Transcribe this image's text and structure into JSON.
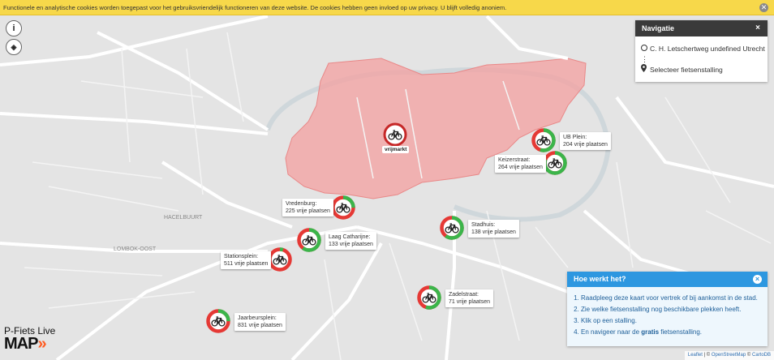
{
  "cookie": {
    "text": "Functionele en analytische cookies worden toegepast voor het gebruiksvriendelijk functioneren van deze website. De cookies hebben geen invloed op uw privacy. U blijft volledig anoniem.",
    "close_icon": "✕"
  },
  "map_controls": {
    "info_glyph": "i",
    "directions_glyph": "◈"
  },
  "map_labels": {
    "district1": "HACELBUURT",
    "district2": "LOMBOK-OOST"
  },
  "navigation": {
    "title": "Navigatie",
    "close": "×",
    "origin": "C. H. Letschertweg undefined Utrecht",
    "separator": "⋮",
    "destination": "Selecteer fietsenstalling"
  },
  "stalls": [
    {
      "name": "UB Plein:",
      "free": "204 vrije plaatsen",
      "free_count": 204,
      "fraction_free": 0.55
    },
    {
      "name": "Keizerstraat:",
      "free": "264 vrije plaatsen",
      "free_count": 264,
      "fraction_free": 0.8
    },
    {
      "name": "Vredenburg:",
      "free": "225 vrije plaatsen",
      "free_count": 225,
      "fraction_free": 0.25
    },
    {
      "name": "Laag Catharijne:",
      "free": "133 vrije plaatsen",
      "free_count": 133,
      "fraction_free": 0.6
    },
    {
      "name": "Stationsplein:",
      "free": "511 vrije plaatsen",
      "free_count": 511,
      "fraction_free": 0.05
    },
    {
      "name": "Stadhuis:",
      "free": "138 vrije plaatsen",
      "free_count": 138,
      "fraction_free": 0.6
    },
    {
      "name": "Zadelstraat:",
      "free": "71 vrije plaatsen",
      "free_count": 71,
      "fraction_free": 0.55
    },
    {
      "name": "Jaarbeursplein:",
      "free": "831 vrije plaatsen",
      "free_count": 831,
      "fraction_free": 0.25
    }
  ],
  "vrijmarkt": {
    "label": "vrijmarkt"
  },
  "help": {
    "title": "Hoe werkt het?",
    "close": "×",
    "steps": [
      "Raadpleeg deze kaart voor vertrek of bij aankomst in de stad.",
      "Zie welke fietsenstalling nog beschikbare plekken heeft.",
      "Klik op een stalling."
    ],
    "step4_prefix": "En navigeer naar de ",
    "step4_bold": "gratis",
    "step4_suffix": " fietsenstalling."
  },
  "attribution": {
    "leaflet": "Leaflet",
    "sep": " | © ",
    "osm": "OpenStreetMap",
    "sep2": " © ",
    "carto": "CartoDB"
  },
  "brand": {
    "name": "P-Fiets Live",
    "logo": "MAP",
    "arrow": "»"
  },
  "colors": {
    "free": "#3bb54a",
    "occupied": "#e53935",
    "zone": "#f4a0a0",
    "help_accent": "#2d97e0"
  }
}
